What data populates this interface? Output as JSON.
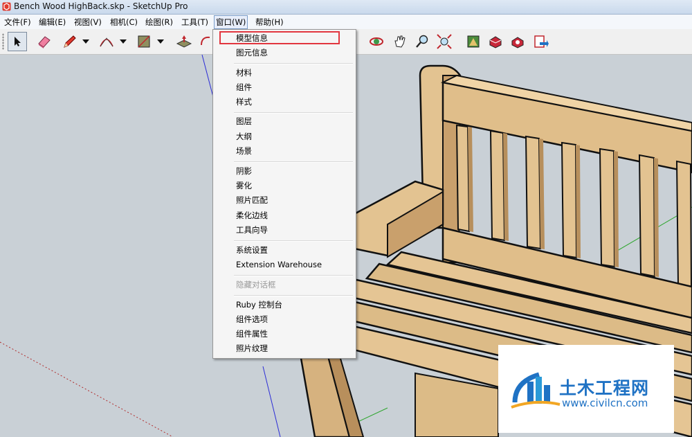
{
  "window": {
    "title": "Bench Wood HighBack.skp - SketchUp Pro"
  },
  "menubar": {
    "items": [
      {
        "label": "文件(F)"
      },
      {
        "label": "编辑(E)"
      },
      {
        "label": "视图(V)"
      },
      {
        "label": "相机(C)"
      },
      {
        "label": "绘图(R)"
      },
      {
        "label": "工具(T)"
      },
      {
        "label": "窗口(W)"
      },
      {
        "label": "帮助(H)"
      }
    ],
    "active": "窗口(W)"
  },
  "window_menu": {
    "items": [
      {
        "label": "模型信息",
        "highlighted": true
      },
      {
        "label": "图元信息"
      },
      {
        "label": "材料"
      },
      {
        "label": "组件"
      },
      {
        "label": "样式"
      },
      {
        "label": "图层"
      },
      {
        "label": "大纲"
      },
      {
        "label": "场景"
      },
      {
        "label": "阴影"
      },
      {
        "label": "雾化"
      },
      {
        "label": "照片匹配"
      },
      {
        "label": "柔化边线"
      },
      {
        "label": "工具向导"
      },
      {
        "label": "系统设置"
      },
      {
        "label": "Extension Warehouse"
      },
      {
        "label": "隐藏对话框",
        "disabled": true
      },
      {
        "label": "Ruby 控制台"
      },
      {
        "label": "组件选项"
      },
      {
        "label": "组件属性"
      },
      {
        "label": "照片纹理"
      }
    ]
  },
  "toolbar": {
    "tools": [
      "select-icon",
      "eraser-icon",
      "pencil-icon",
      "arc-icon",
      "rectangle-icon",
      "push-pull-icon",
      "orbit-icon",
      "pan-icon",
      "zoom-icon",
      "zoom-extents-icon",
      "3d-warehouse-icon",
      "share-component-icon",
      "get-models-icon",
      "send-to-layout-icon"
    ]
  },
  "watermark": {
    "brand": "土木工程网",
    "url": "www.civilcn.com"
  },
  "colors": {
    "highlight_box": "#e2363f",
    "wood": "#d9b788",
    "background": "#c9d0d6",
    "brand": "#1f72c4"
  }
}
